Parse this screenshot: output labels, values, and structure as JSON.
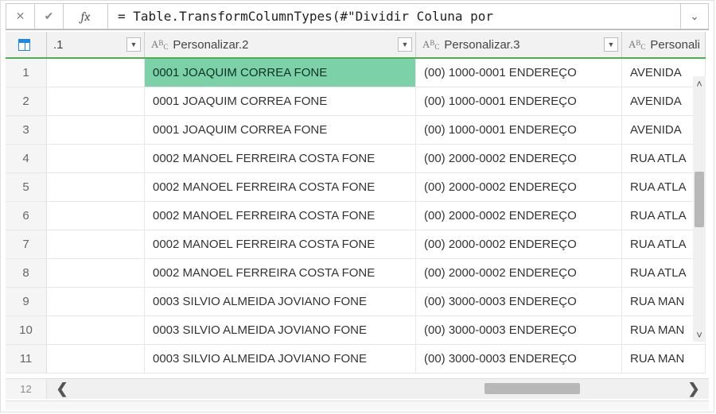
{
  "formula_bar": {
    "cancel_icon": "✕",
    "confirm_icon": "✔",
    "fx_label": "fx",
    "formula": "= Table.TransformColumnTypes(#\"Dividir Coluna por",
    "expand_icon": "⌄"
  },
  "columns": {
    "rownum_header_icon": "table",
    "c1": {
      "label": ".1",
      "type_icon": "num"
    },
    "c2": {
      "label": "Personalizar.2",
      "type_icon": "text"
    },
    "c3": {
      "label": "Personalizar.3",
      "type_icon": "text"
    },
    "c4": {
      "label": "Personali",
      "type_icon": "text"
    }
  },
  "rows": [
    {
      "n": "1",
      "c1": "",
      "c2": "0001 JOAQUIM CORREA FONE",
      "c3": "(00) 1000-0001  ENDEREÇO",
      "c4": "AVENIDA",
      "selected": true
    },
    {
      "n": "2",
      "c1": "",
      "c2": "0001 JOAQUIM CORREA FONE",
      "c3": "(00) 1000-0001  ENDEREÇO",
      "c4": "AVENIDA"
    },
    {
      "n": "3",
      "c1": "",
      "c2": "0001 JOAQUIM CORREA FONE",
      "c3": "(00) 1000-0001  ENDEREÇO",
      "c4": "AVENIDA"
    },
    {
      "n": "4",
      "c1": "",
      "c2": "0002 MANOEL FERREIRA COSTA FONE",
      "c3": "(00) 2000-0002  ENDEREÇO",
      "c4": "RUA ATLA"
    },
    {
      "n": "5",
      "c1": "",
      "c2": "0002 MANOEL FERREIRA COSTA FONE",
      "c3": "(00) 2000-0002  ENDEREÇO",
      "c4": "RUA ATLA"
    },
    {
      "n": "6",
      "c1": "",
      "c2": "0002 MANOEL FERREIRA COSTA FONE",
      "c3": "(00) 2000-0002  ENDEREÇO",
      "c4": "RUA ATLA"
    },
    {
      "n": "7",
      "c1": "",
      "c2": "0002 MANOEL FERREIRA COSTA FONE",
      "c3": "(00) 2000-0002  ENDEREÇO",
      "c4": "RUA ATLA"
    },
    {
      "n": "8",
      "c1": "",
      "c2": "0002 MANOEL FERREIRA COSTA FONE",
      "c3": "(00) 2000-0002  ENDEREÇO",
      "c4": "RUA ATLA"
    },
    {
      "n": "9",
      "c1": "",
      "c2": "0003 SILVIO ALMEIDA JOVIANO FONE",
      "c3": "(00) 3000-0003  ENDEREÇO",
      "c4": "RUA MAN"
    },
    {
      "n": "10",
      "c1": "",
      "c2": "0003 SILVIO ALMEIDA JOVIANO FONE",
      "c3": "(00) 3000-0003  ENDEREÇO",
      "c4": "RUA MAN"
    },
    {
      "n": "11",
      "c1": "",
      "c2": "0003 SILVIO ALMEIDA JOVIANO FONE",
      "c3": "(00) 3000-0003  ENDEREÇO",
      "c4": "RUA MAN"
    }
  ],
  "partial_row_num": "12",
  "scroll": {
    "up_icon": "˄",
    "down_icon": "˅",
    "left_icon": "❮",
    "right_icon": "❯"
  }
}
